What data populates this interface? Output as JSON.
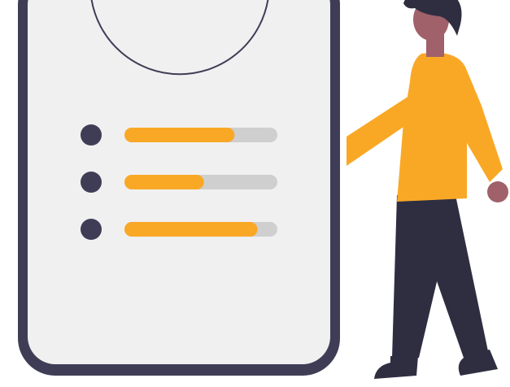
{
  "colors": {
    "frame": "#3f3d56",
    "screen": "#f0f0f0",
    "accent": "#f9a826",
    "track": "#cfcfcf",
    "skin": "#a0616a",
    "hair": "#2f2e41",
    "pants": "#2f2e41",
    "white": "#ffffff"
  },
  "progress_items": [
    {
      "icon": "bullet-dot",
      "value": 0.72
    },
    {
      "icon": "bullet-dot",
      "value": 0.52
    },
    {
      "icon": "bullet-dot",
      "value": 0.87
    }
  ]
}
